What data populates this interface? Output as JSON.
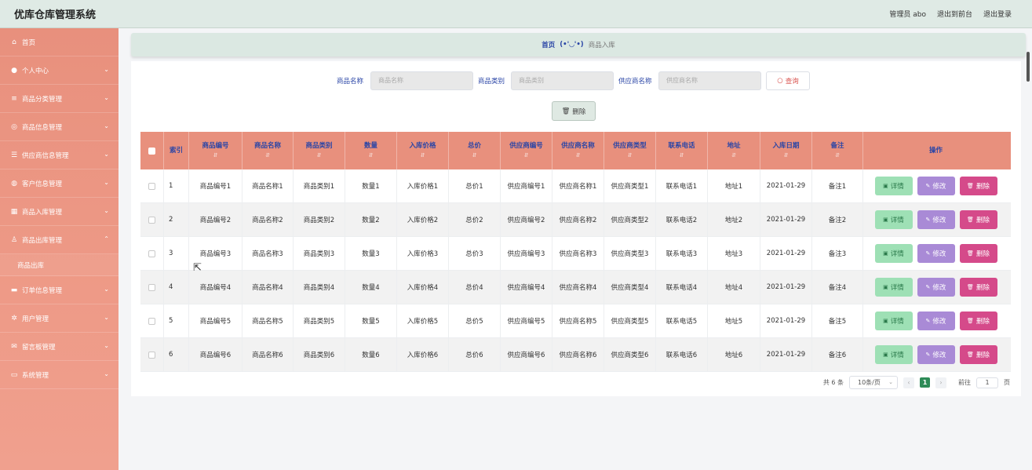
{
  "app_title": "优库仓库管理系统",
  "header": {
    "admin_label": "管理员 abo",
    "front_label": "退出到前台",
    "logout_label": "退出登录"
  },
  "sidebar": {
    "items": [
      {
        "label": "首页",
        "icon": "home-icon"
      },
      {
        "label": "个人中心",
        "icon": "user-icon"
      },
      {
        "label": "商品分类管理",
        "icon": "sliders-icon"
      },
      {
        "label": "商品信息管理",
        "icon": "info-icon"
      },
      {
        "label": "供应商信息管理",
        "icon": "list-icon"
      },
      {
        "label": "客户信息管理",
        "icon": "globe-icon"
      },
      {
        "label": "商品入库管理",
        "icon": "grid-icon"
      },
      {
        "label": "商品出库管理",
        "icon": "users-icon"
      },
      {
        "label": "订单信息管理",
        "icon": "monitor-icon"
      },
      {
        "label": "用户管理",
        "icon": "gear-icon"
      },
      {
        "label": "留言板管理",
        "icon": "mail-icon"
      },
      {
        "label": "系统管理",
        "icon": "window-icon"
      }
    ],
    "sub_item": "商品出库"
  },
  "breadcrumb": {
    "home": "首页",
    "face": "(•'◡'•)",
    "current": "商品入库"
  },
  "search": {
    "name_label": "商品名称",
    "name_placeholder": "商品名称",
    "category_label": "商品类别",
    "category_placeholder": "商品类别",
    "supplier_label": "供应商名称",
    "supplier_placeholder": "供应商名称",
    "query_label": "查询"
  },
  "delete_label": "删除",
  "table": {
    "headers": [
      "索引",
      "商品编号",
      "商品名称",
      "商品类别",
      "数量",
      "入库价格",
      "总价",
      "供应商编号",
      "供应商名称",
      "供应商类型",
      "联系电话",
      "地址",
      "入库日期",
      "备注",
      "操作"
    ],
    "rows": [
      [
        "1",
        "商品编号1",
        "商品名称1",
        "商品类别1",
        "数量1",
        "入库价格1",
        "总价1",
        "供应商编号1",
        "供应商名称1",
        "供应商类型1",
        "联系电话1",
        "地址1",
        "2021-01-29",
        "备注1"
      ],
      [
        "2",
        "商品编号2",
        "商品名称2",
        "商品类别2",
        "数量2",
        "入库价格2",
        "总价2",
        "供应商编号2",
        "供应商名称2",
        "供应商类型2",
        "联系电话2",
        "地址2",
        "2021-01-29",
        "备注2"
      ],
      [
        "3",
        "商品编号3",
        "商品名称3",
        "商品类别3",
        "数量3",
        "入库价格3",
        "总价3",
        "供应商编号3",
        "供应商名称3",
        "供应商类型3",
        "联系电话3",
        "地址3",
        "2021-01-29",
        "备注3"
      ],
      [
        "4",
        "商品编号4",
        "商品名称4",
        "商品类别4",
        "数量4",
        "入库价格4",
        "总价4",
        "供应商编号4",
        "供应商名称4",
        "供应商类型4",
        "联系电话4",
        "地址4",
        "2021-01-29",
        "备注4"
      ],
      [
        "5",
        "商品编号5",
        "商品名称5",
        "商品类别5",
        "数量5",
        "入库价格5",
        "总价5",
        "供应商编号5",
        "供应商名称5",
        "供应商类型5",
        "联系电话5",
        "地址5",
        "2021-01-29",
        "备注5"
      ],
      [
        "6",
        "商品编号6",
        "商品名称6",
        "商品类别6",
        "数量6",
        "入库价格6",
        "总价6",
        "供应商编号6",
        "供应商名称6",
        "供应商类型6",
        "联系电话6",
        "地址6",
        "2021-01-29",
        "备注6"
      ]
    ],
    "actions": {
      "detail": "详情",
      "edit": "修改",
      "delete": "删除"
    }
  },
  "pagination": {
    "total": "共 6 条",
    "page_size": "10条/页",
    "current_page": "1",
    "goto_label": "前往",
    "goto_value": "1",
    "page_suffix": "页"
  },
  "colors": {
    "sidebar": "#e8907d",
    "header_bg": "#dfeae5",
    "accent_blue": "#2a45a6",
    "detail": "#9ee0b5",
    "edit": "#a98ad6",
    "delete": "#d54a8a",
    "pager_active": "#2e8b57"
  }
}
